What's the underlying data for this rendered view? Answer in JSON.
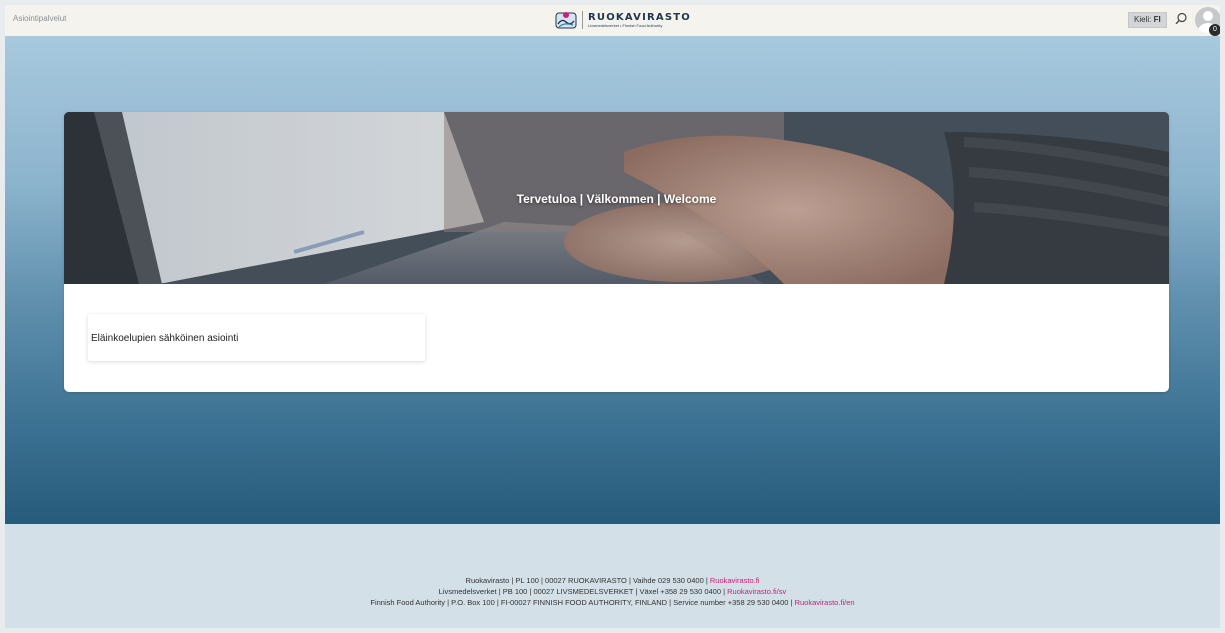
{
  "header": {
    "service_link": "Asiointipalvelut",
    "logo": {
      "brand": "RUOKAVIRASTO",
      "tagline": "Livsmedelsverket • Finnish Food Authority"
    },
    "language": {
      "label": "Kieli:",
      "value": "FI"
    },
    "notification_count": "0"
  },
  "banner": {
    "title": "Tervetuloa | Välkommen | Welcome"
  },
  "tiles": [
    {
      "label": "Eläinkoelupien sähköinen asiointi"
    }
  ],
  "footer": {
    "lines": [
      {
        "text": "Ruokavirasto | PL 100 | 00027 RUOKAVIRASTO | Vaihde 029 530 0400 | ",
        "link": "Ruokavirasto.fi"
      },
      {
        "text": "Livsmedelsverket | PB 100 | 00027 LIVSMEDELSVERKET | Växel +358 29 530 0400 | ",
        "link": "Ruokavirasto.fi/sv"
      },
      {
        "text": "Finnish Food Authority | P.O. Box 100 | FI-00027 FINNISH FOOD AUTHORITY, FINLAND | Service number +358 29 530 0400 | ",
        "link": "Ruokavirasto.fi/en"
      }
    ]
  },
  "colors": {
    "link": "#c8207a",
    "brand_navy": "#1f3550",
    "gradient_top": "#a8c9de",
    "gradient_bottom": "#275b7c"
  },
  "icons": [
    "search-icon",
    "avatar-icon",
    "ruokavirasto-logo-icon"
  ]
}
